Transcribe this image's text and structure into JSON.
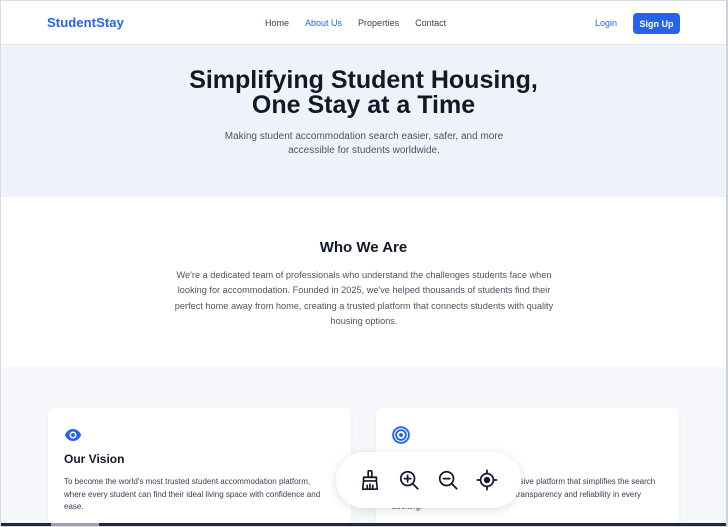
{
  "nav": {
    "brand": "StudentStay",
    "links": [
      {
        "label": "Home",
        "active": false
      },
      {
        "label": "About Us",
        "active": true
      },
      {
        "label": "Properties",
        "active": false
      },
      {
        "label": "Contact",
        "active": false
      }
    ],
    "login": "Login",
    "signup": "Sign Up"
  },
  "hero": {
    "title_line1": "Simplifying Student Housing,",
    "title_line2": "One Stay at a Time",
    "subtitle": "Making student accommodation search easier, safer, and more accessible for students worldwide."
  },
  "who": {
    "heading": "Who We Are",
    "body": "We're a dedicated team of professionals who understand the challenges students face when looking for accommodation. Founded in 2025, we've helped thousands of students find their perfect home away from home, creating a trusted platform that connects students with quality housing options."
  },
  "cards": {
    "vision": {
      "icon": "eye-icon",
      "title": "Our Vision",
      "text": "To become the world's most trusted student accommodation platform, where every student can find their ideal living space with confidence and ease."
    },
    "mission": {
      "icon": "target-icon",
      "text": "To provide a secure and comprehensive platform that simplifies the search for accommodation while ensuring transparency and reliability in every booking."
    }
  },
  "toolbar": {
    "tools": [
      "broom-icon",
      "zoom-in-icon",
      "zoom-out-icon",
      "crosshair-icon"
    ]
  },
  "colors": {
    "accent": "#2563eb",
    "hero_bg": "#eef2fb",
    "section_bg": "#f5f7fb"
  }
}
